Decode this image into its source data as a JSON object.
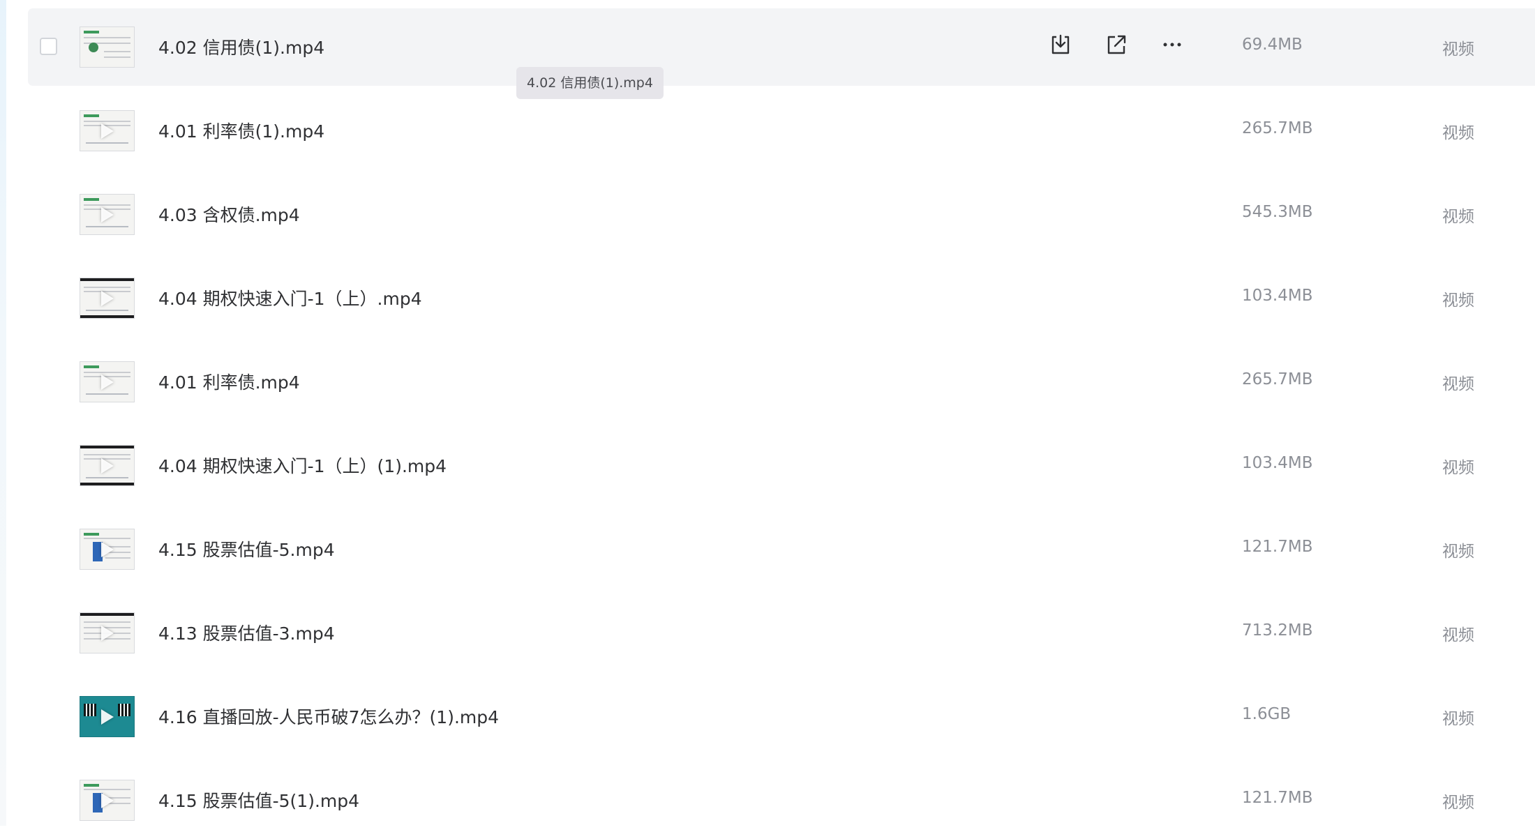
{
  "tooltip": "4.02 信用债(1).mp4",
  "actions": {
    "download": "download",
    "share": "share",
    "more": "more"
  },
  "files": [
    {
      "name": "4.02 信用债(1).mp4",
      "size": "69.4MB",
      "type": "视频"
    },
    {
      "name": "4.01 利率债(1).mp4",
      "size": "265.7MB",
      "type": "视频"
    },
    {
      "name": "4.03 含权债.mp4",
      "size": "545.3MB",
      "type": "视频"
    },
    {
      "name": "4.04 期权快速入门-1（上）.mp4",
      "size": "103.4MB",
      "type": "视频"
    },
    {
      "name": "4.01 利率债.mp4",
      "size": "265.7MB",
      "type": "视频"
    },
    {
      "name": "4.04 期权快速入门-1（上）(1).mp4",
      "size": "103.4MB",
      "type": "视频"
    },
    {
      "name": "4.15 股票估值-5.mp4",
      "size": "121.7MB",
      "type": "视频"
    },
    {
      "name": "4.13 股票估值-3.mp4",
      "size": "713.2MB",
      "type": "视频"
    },
    {
      "name": "4.16 直播回放-人民币破7怎么办？(1).mp4",
      "size": "1.6GB",
      "type": "视频"
    },
    {
      "name": "4.15 股票估值-5(1).mp4",
      "size": "121.7MB",
      "type": "视频"
    }
  ]
}
